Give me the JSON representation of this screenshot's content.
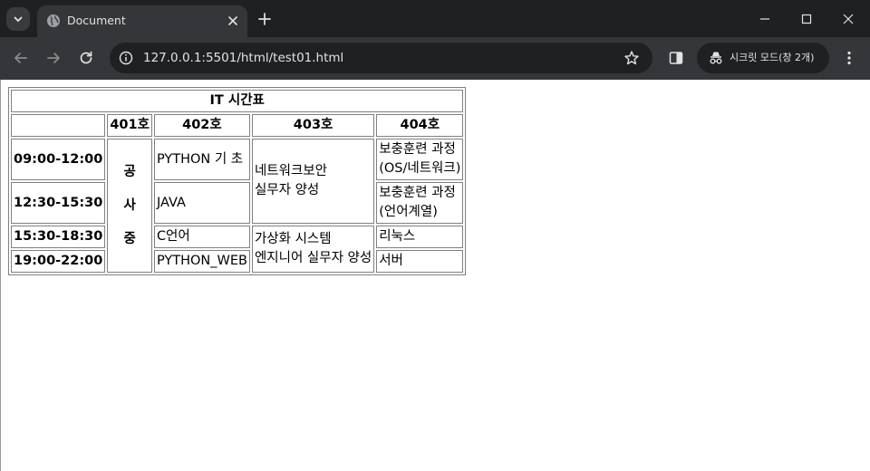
{
  "browser": {
    "tab_title": "Document",
    "url": "127.0.0.1:5501/html/test01.html",
    "incognito_label": "시크릿 모드(창 2개)",
    "colors": {
      "chrome_dark": "#1f2021",
      "chrome_toolbar": "#35363a",
      "text": "#e3e3e3"
    }
  },
  "table": {
    "caption": "IT 시간표",
    "rooms": [
      "401호",
      "402호",
      "403호",
      "404호"
    ],
    "times": [
      "09:00-12:00",
      "12:30-15:30",
      "15:30-18:30",
      "19:00-22:00"
    ],
    "room401_closed": [
      "공",
      "사",
      "중"
    ],
    "room402": [
      "PYTHON 기 초",
      "JAVA",
      "C언어",
      "PYTHON_WEB"
    ],
    "room403": [
      {
        "line1": "네트워크보안",
        "line2": "실무자 양성"
      },
      {
        "line1": "가상화 시스템",
        "line2": "엔지니어 실무자 양성"
      }
    ],
    "room404": [
      {
        "line1": "보충훈련 과정",
        "line2": "(OS/네트워크)"
      },
      {
        "line1": "보충훈련 과정",
        "line2": "(언어계열)"
      },
      {
        "line1": "리눅스"
      },
      {
        "line1": "서버"
      }
    ]
  }
}
